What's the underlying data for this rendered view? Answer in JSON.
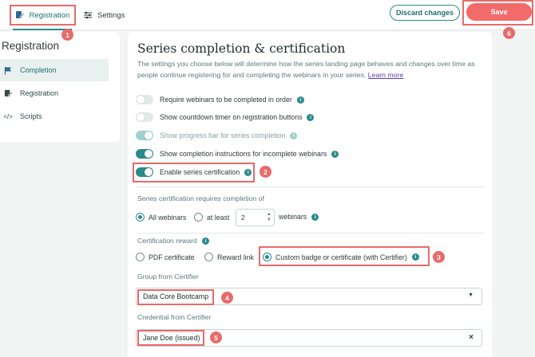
{
  "topbar": {
    "tabs": [
      {
        "label": "Registration",
        "icon": "edit-doc-icon"
      },
      {
        "label": "Settings",
        "icon": "sliders-icon"
      }
    ],
    "discard_label": "Discard changes",
    "save_label": "Save"
  },
  "badges": [
    "1",
    "2",
    "3",
    "4",
    "5",
    "6"
  ],
  "sidebar": {
    "title": "Registration",
    "items": [
      {
        "label": "Completion",
        "icon": "flag-icon",
        "active": true
      },
      {
        "label": "Registration",
        "icon": "edit-doc-icon",
        "active": false
      },
      {
        "label": "Scripts",
        "icon": "code-icon",
        "active": false
      }
    ]
  },
  "main": {
    "title": "Series completion & certification",
    "description": "The settings you choose below will determine how the series landing page behaves and changes over time as people continue registering for and completing the webinars in your series.",
    "learn_more": "Learn more",
    "toggles": [
      {
        "label": "Require webinars to be completed in order",
        "on": false
      },
      {
        "label": "Show countdown timer on registration buttons",
        "on": false
      },
      {
        "label": "Show progress bar for series completion",
        "on": true,
        "disabled": true
      },
      {
        "label": "Show completion instructions for incomplete webinars",
        "on": true
      },
      {
        "label": "Enable series certification",
        "on": true
      }
    ],
    "requires_label": "Series certification requires completion of",
    "requires_options": {
      "all": "All webinars",
      "at_least": "at least",
      "count": "2",
      "unit": "webinars"
    },
    "reward_label": "Certification reward",
    "reward_options": [
      "PDF certificate",
      "Reward link",
      "Custom badge or certificate (with Certifier)"
    ],
    "group_label": "Group from Certifier",
    "group_value": "Data Core Bootcamp",
    "credential_label": "Credential from Certifier",
    "credential_value": "Jane Doe (issued)"
  },
  "colors": {
    "accent": "#2a8a8c",
    "save": "#f26a6a",
    "highlight": "#e86a6a"
  }
}
